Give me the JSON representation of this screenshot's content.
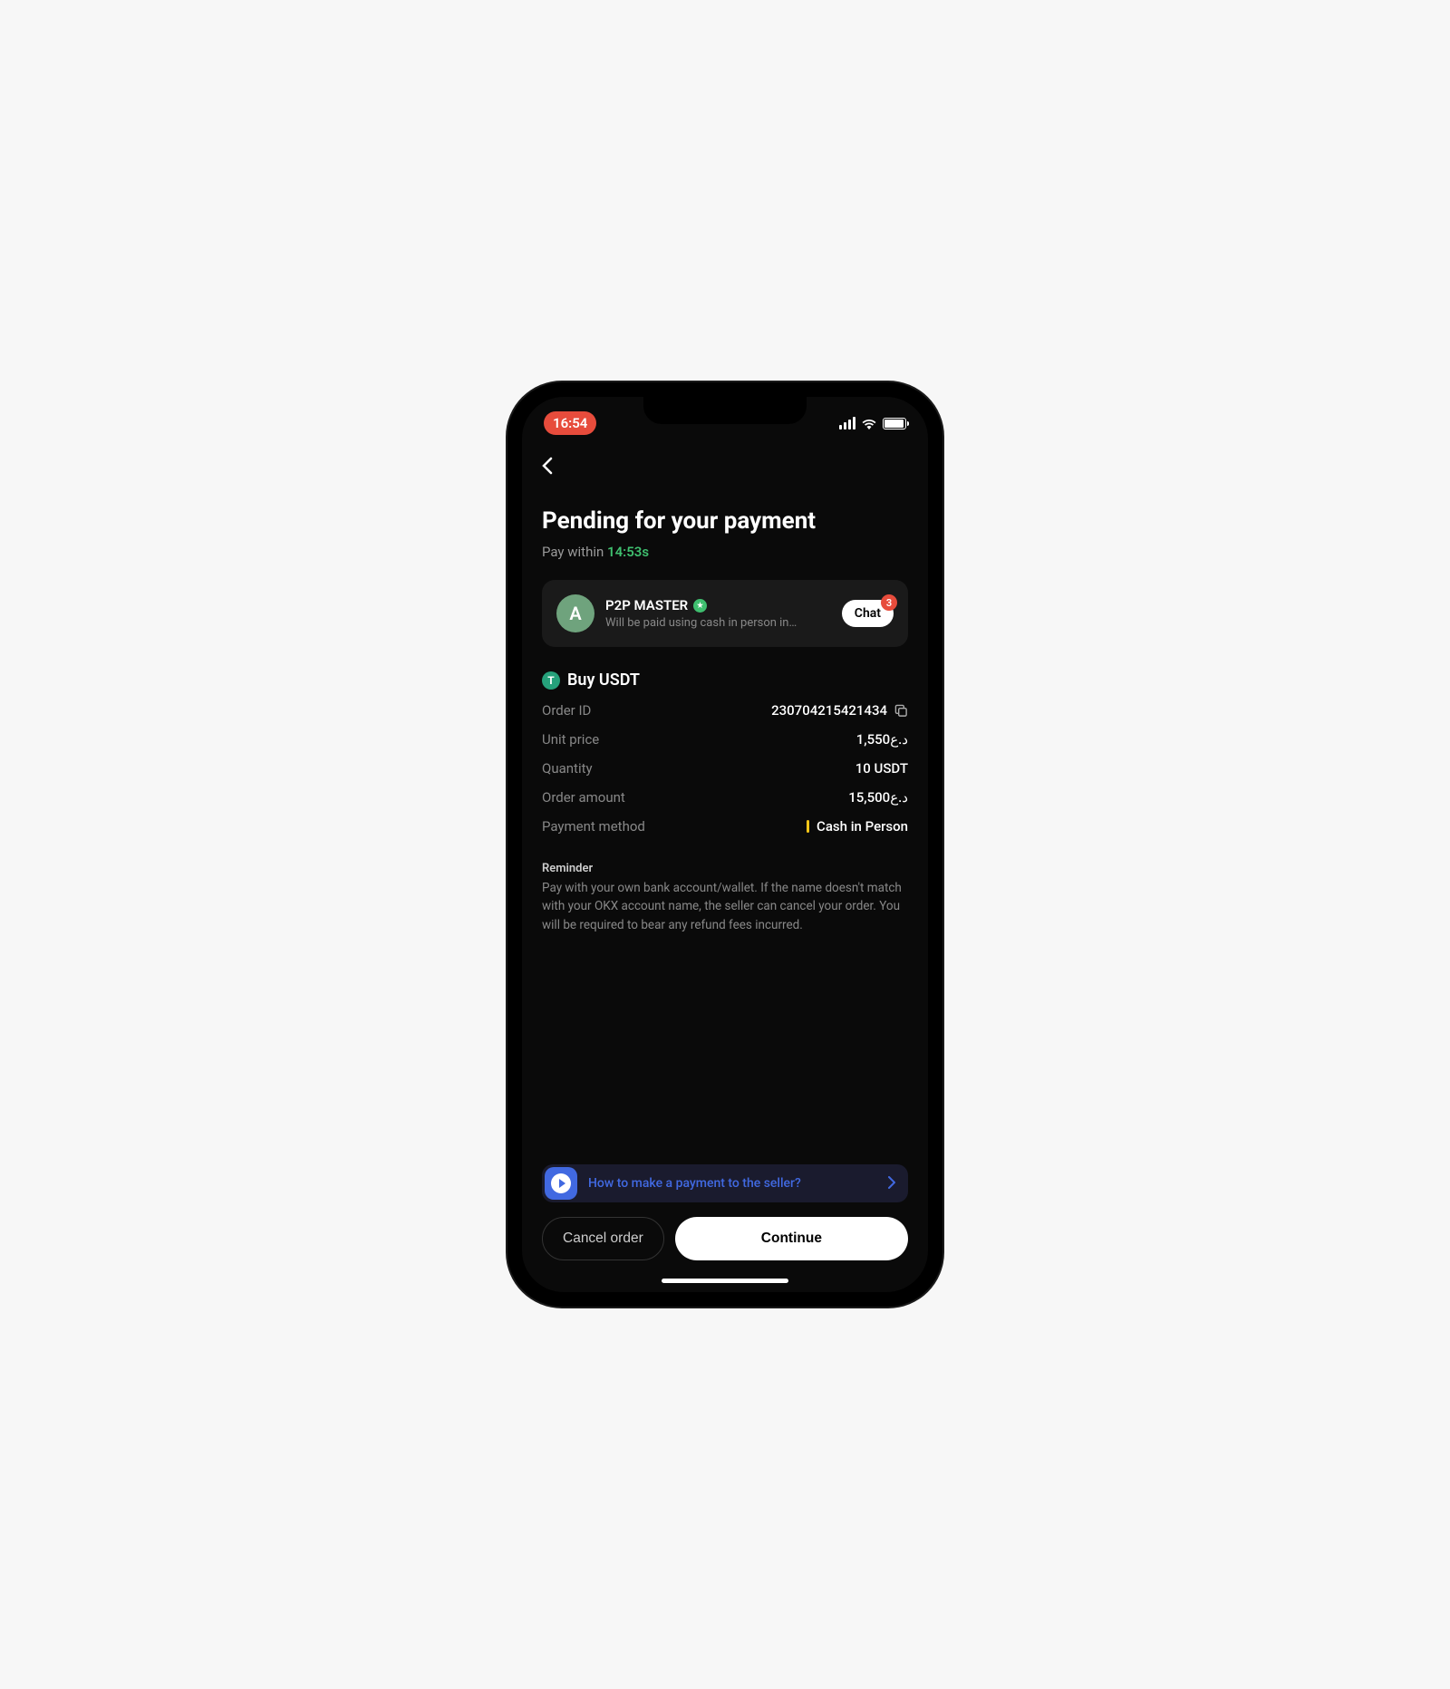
{
  "statusBar": {
    "time": "16:54"
  },
  "header": {
    "title": "Pending for your payment",
    "payWithinLabel": "Pay within",
    "timer": "14:53s"
  },
  "seller": {
    "avatarLetter": "A",
    "name": "P2P MASTER",
    "desc": "Will be paid using cash in person in…",
    "chatLabel": "Chat",
    "chatBadge": "3"
  },
  "order": {
    "tokenLetter": "T",
    "buyLabel": "Buy USDT",
    "orderIdLabel": "Order ID",
    "orderIdValue": "230704215421434",
    "unitPriceLabel": "Unit price",
    "unitPriceValue": "1,550‎د.ع",
    "quantityLabel": "Quantity",
    "quantityValue": "10 USDT",
    "orderAmountLabel": "Order amount",
    "orderAmountValue": "15,500‎د.ع",
    "paymentMethodLabel": "Payment method",
    "paymentMethodValue": "Cash in Person"
  },
  "reminder": {
    "title": "Reminder",
    "text": "Pay with your own bank account/wallet. If the name doesn't match with your OKX account name, the seller can cancel your order. You will be required to bear any refund fees incurred."
  },
  "help": {
    "text": "How to make a payment to the seller?"
  },
  "buttons": {
    "cancel": "Cancel order",
    "continue": "Continue"
  },
  "colors": {
    "accent_green": "#3fbf6f",
    "accent_red": "#e74c3c",
    "accent_blue": "#4169e1",
    "accent_yellow": "#f5c518"
  }
}
